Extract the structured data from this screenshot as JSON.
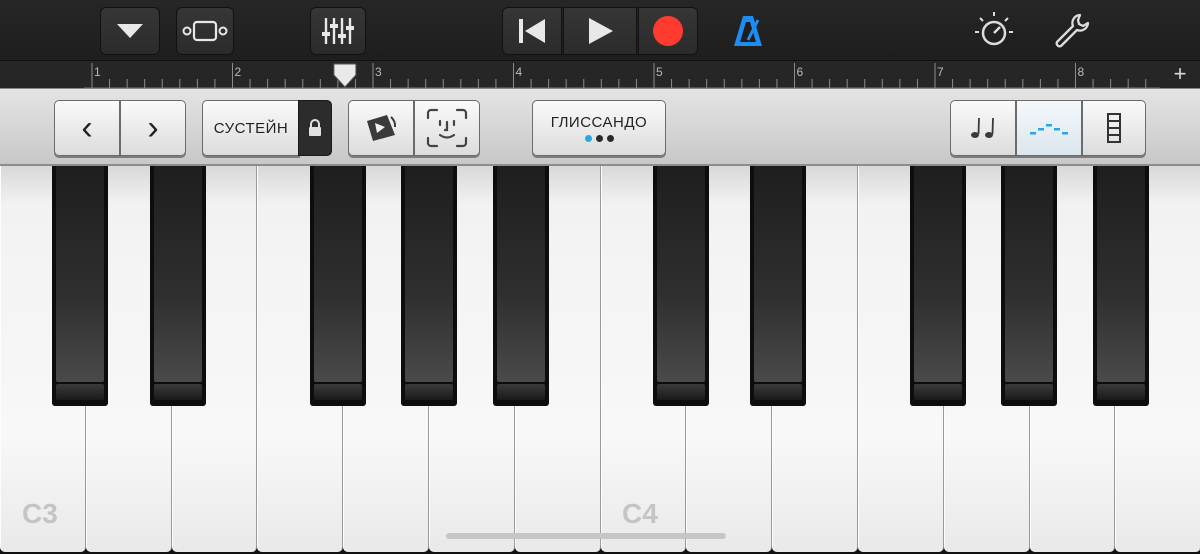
{
  "toolbar": {
    "buttons": [
      {
        "name": "browser-dropdown-button",
        "icon": "triangle-down-icon"
      },
      {
        "name": "tracks-view-button",
        "icon": "tracks-view-icon"
      },
      {
        "name": "mixer-button",
        "icon": "mixer-sliders-icon"
      },
      {
        "name": "go-to-start-button",
        "icon": "skip-back-icon"
      },
      {
        "name": "play-button",
        "icon": "play-icon"
      },
      {
        "name": "record-button",
        "icon": "record-icon"
      },
      {
        "name": "metronome-button",
        "icon": "metronome-icon"
      },
      {
        "name": "master-effects-button",
        "icon": "knob-icon"
      },
      {
        "name": "settings-button",
        "icon": "wrench-icon"
      }
    ],
    "colors": {
      "record": "#ff3b30",
      "metronome": "#1e8cf0"
    }
  },
  "ruler": {
    "bars": [
      "1",
      "2",
      "3",
      "4",
      "5",
      "6",
      "7",
      "8"
    ],
    "playhead_bar": 2.8,
    "add_section_label": "+"
  },
  "controls": {
    "octave_down_label": "‹",
    "octave_up_label": "›",
    "sustain_label": "СУСТЕЙН",
    "sustain_lock_icon": "lock-icon",
    "loops_icon": "loop-icon",
    "face_control_icon": "face-icon",
    "glissando_label": "ГЛИССАНДО",
    "glissando_mode_dots": 3,
    "glissando_active_dot": 1,
    "right_buttons": [
      {
        "name": "notes-button",
        "icon": "notes-icon"
      },
      {
        "name": "arpeggiator-button",
        "icon": "arpeggio-icon",
        "active": true
      },
      {
        "name": "key-size-button",
        "icon": "keyboard-size-icon"
      }
    ],
    "accent_color": "#29a8df"
  },
  "keyboard": {
    "labels": {
      "c3": "C3",
      "c4": "C4"
    }
  }
}
